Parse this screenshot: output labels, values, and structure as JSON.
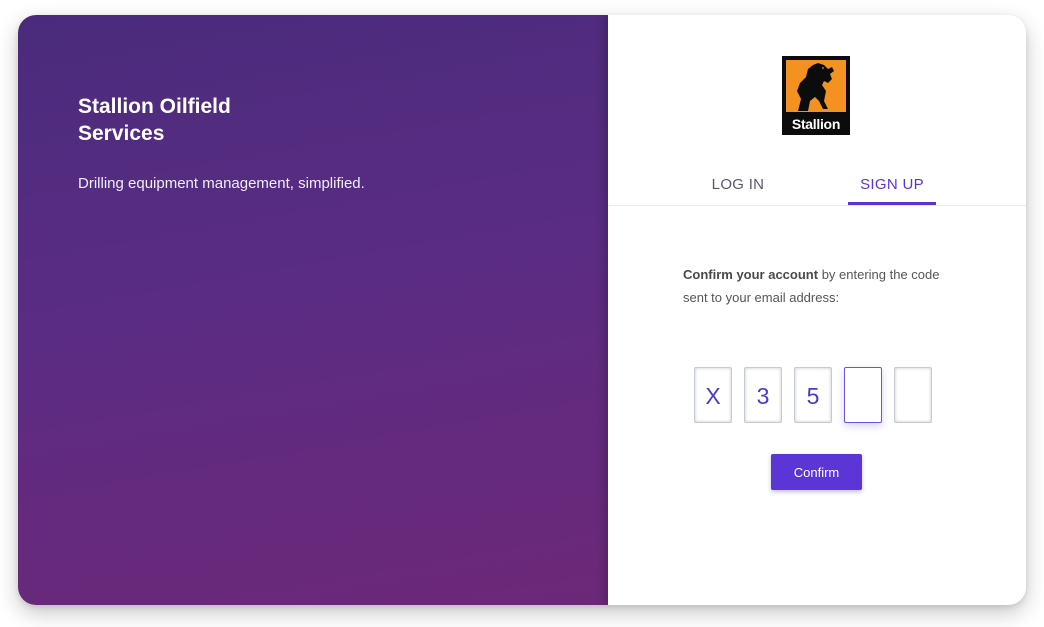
{
  "hero": {
    "title": "Stallion Oilfield Services",
    "subtitle": "Drilling equipment management, simplified."
  },
  "logo": {
    "text": "Stallion",
    "icon": "stallion-horse-logo",
    "colors": {
      "background": "#0c0c0c",
      "accent": "#f39221"
    }
  },
  "tabs": [
    {
      "label": "LOG IN",
      "active": false
    },
    {
      "label": "SIGN UP",
      "active": true
    }
  ],
  "instructions": {
    "strong": "Confirm your account",
    "rest_line1": " by entering the code",
    "rest_line2": "sent to your email address:"
  },
  "code": {
    "digits": [
      "X",
      "3",
      "5",
      "",
      ""
    ]
  },
  "confirm_label": "Confirm",
  "colors": {
    "accent": "#5b35d5",
    "hero_gradient_start": "#4a2b7b",
    "hero_gradient_end": "#6d2878"
  }
}
